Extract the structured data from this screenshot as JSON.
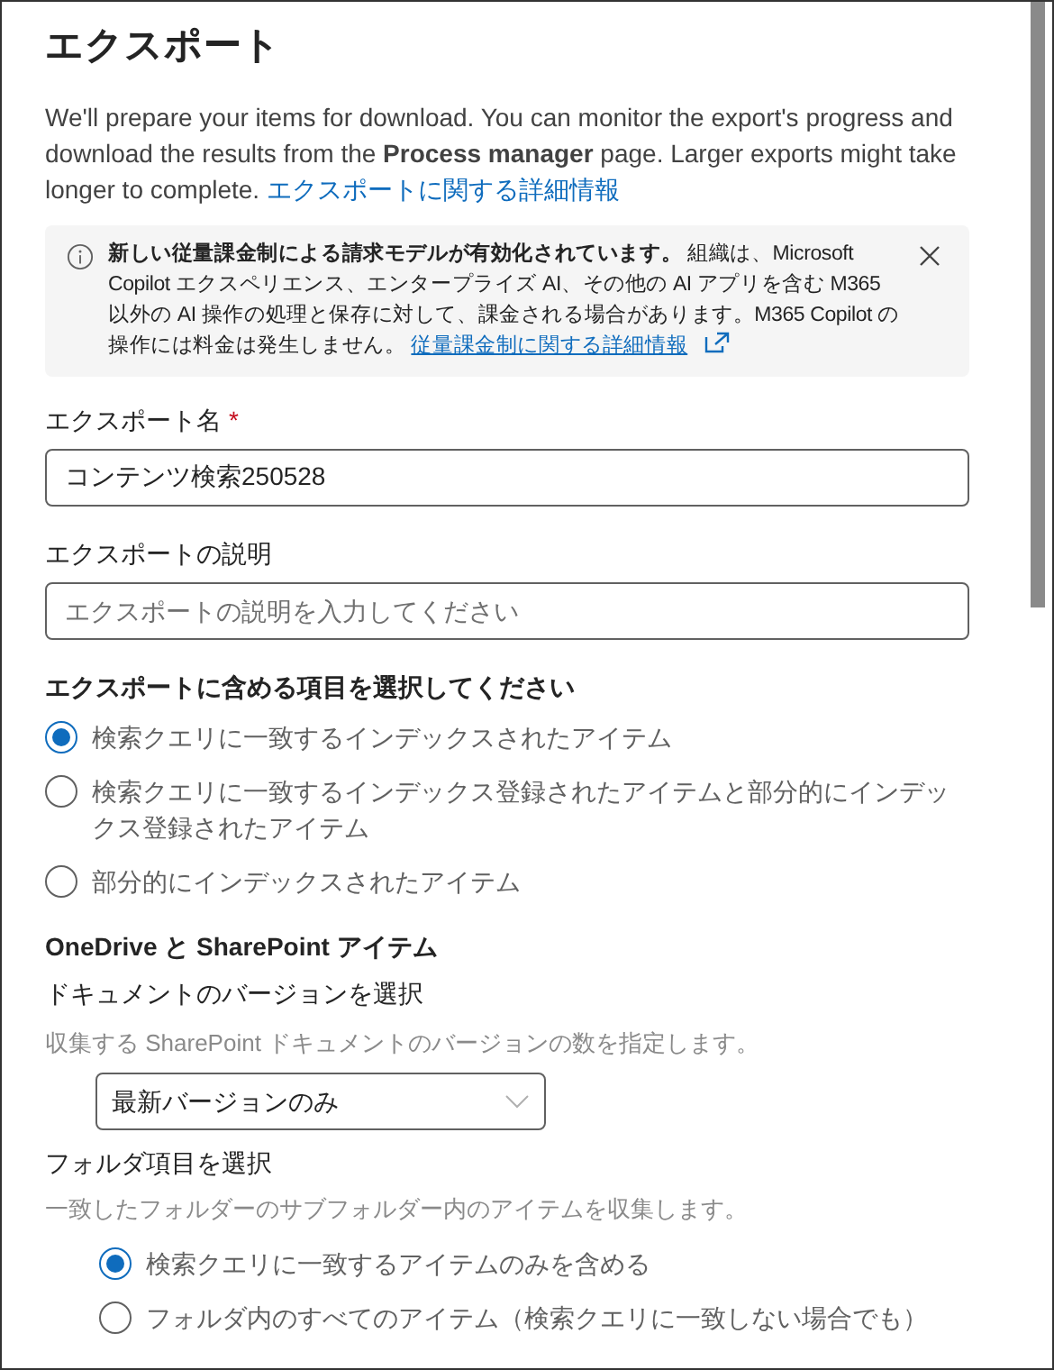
{
  "title": "エクスポート",
  "intro": {
    "text": "We'll prepare your items for download. You can monitor the export's progress and download the results from the **Process manager** page. Larger exports might take longer to complete.",
    "link": "エクスポートに関する詳細情報"
  },
  "notice": {
    "text": "**新しい従量課金制による請求モデルが有効化されています。** 組織は、Microsoft Copilot エクスペリエンス、エンタープライズ AI、その他の AI アプリを含む M365 以外の AI 操作の処理と保存に対して、課金される場合があります。M365 Copilot の操作には料金は発生しません。",
    "link": "従量課金制に関する詳細情報"
  },
  "name_field": {
    "label": "エクスポート名",
    "required_mark": "*",
    "value": "コンテンツ検索250528"
  },
  "description_field": {
    "label": "エクスポートの説明",
    "placeholder": "エクスポートの説明を入力してください"
  },
  "include_section": {
    "heading": "エクスポートに含める項目を選択してください",
    "options": [
      {
        "label": "検索クエリに一致するインデックスされたアイテム",
        "selected": true
      },
      {
        "label": "検索クエリに一致するインデックス登録されたアイテムと部分的にインデックス登録されたアイテム",
        "selected": false
      },
      {
        "label": "部分的にインデックスされたアイテム",
        "selected": false
      }
    ]
  },
  "onedrive_section": {
    "heading": "OneDrive と SharePoint アイテム",
    "versions": {
      "label": "ドキュメントのバージョンを選択",
      "hint": "収集する SharePoint ドキュメントのバージョンの数を指定します。",
      "value": "最新バージョンのみ"
    },
    "folders": {
      "label": "フォルダ項目を選択",
      "hint": "一致したフォルダーのサブフォルダー内のアイテムを収集します。",
      "options": [
        {
          "label": "検索クエリに一致するアイテムのみを含める",
          "selected": true
        },
        {
          "label": "フォルダ内のすべてのアイテム（検索クエリに一致しない場合でも）",
          "selected": false
        }
      ]
    }
  }
}
